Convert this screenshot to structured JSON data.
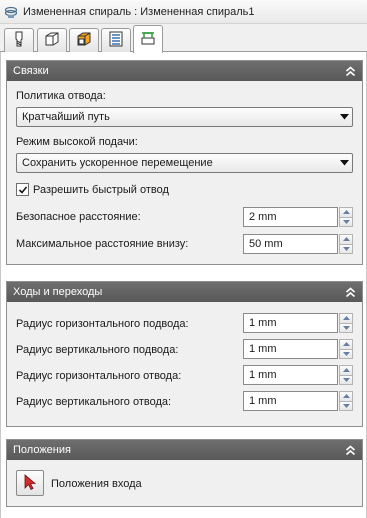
{
  "window": {
    "title": "Измененная спираль : Измененная спираль1",
    "title_icon": "spiral-feature-icon"
  },
  "tabs": [
    {
      "icon": "tool-icon",
      "active": false
    },
    {
      "icon": "shape-icon",
      "active": false
    },
    {
      "icon": "heights-icon",
      "active": false
    },
    {
      "icon": "passes-icon",
      "active": false
    },
    {
      "icon": "linking-icon",
      "active": true
    }
  ],
  "linking": {
    "header": "Связки",
    "retract_policy_label": "Политика отвода:",
    "retract_policy_value": "Кратчайший путь",
    "high_feed_label": "Режим высокой подачи:",
    "high_feed_value": "Сохранить ускоренное перемещение",
    "fast_retract_label": "Разрешить быстрый отвод",
    "fast_retract_checked": true,
    "safe_distance_label": "Безопасное расстояние:",
    "safe_distance_value": "2 mm",
    "max_down_label": "Максимальное расстояние внизу:",
    "max_down_value": "50 mm"
  },
  "leads": {
    "header": "Ходы и переходы",
    "horiz_lead_in_label": "Радиус горизонтального подвода:",
    "horiz_lead_in_value": "1 mm",
    "vert_lead_in_label": "Радиус вертикального подвода:",
    "vert_lead_in_value": "1 mm",
    "horiz_lead_out_label": "Радиус горизонтального отвода:",
    "horiz_lead_out_value": "1 mm",
    "vert_lead_out_label": "Радиус вертикального отвода:",
    "vert_lead_out_value": "1 mm"
  },
  "positions": {
    "header": "Положения",
    "entry_positions_label": "Положения входа"
  },
  "colors": {
    "header_bg": "#606060",
    "panel_bg": "#f0f0f0",
    "accent_red": "#c0282c"
  }
}
